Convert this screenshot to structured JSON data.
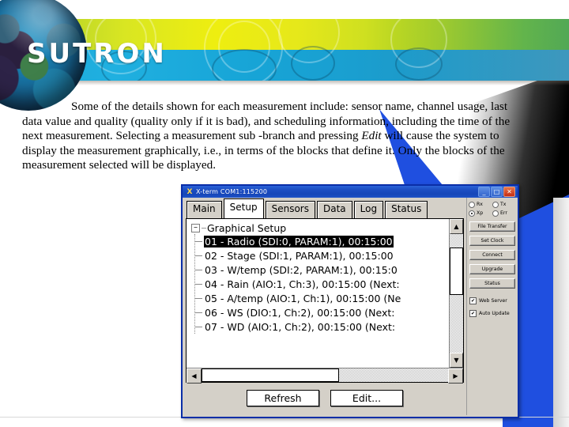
{
  "slide": {
    "brand": "SUTRON",
    "paragraph_runs": [
      {
        "t": "Some of the details shown for each measurement include: sensor name, channel usage, last data value and quality (quality only if it is bad), and scheduling information, including the time of the next measurement. Selecting a measurement sub -branch and pressing ",
        "italic": false
      },
      {
        "t": "Edit",
        "italic": true
      },
      {
        "t": " will cause the system to display the measurement graphically, i.e., in terms of the blocks that define it. Only the blocks of the measurement selected will be displayed.",
        "italic": false
      }
    ],
    "colors": {
      "banner_green": "#cfe020",
      "banner_blue": "#1aa6d8",
      "accent_blue": "#1f4fe0",
      "title_blue": "#1d4fc4"
    }
  },
  "window": {
    "title": "X-term COM1:115200",
    "title_icon": "terminal-icon",
    "controls": {
      "minimize": "_",
      "maximize": "□",
      "close": "✕"
    },
    "tabs": [
      {
        "label": "Main",
        "active": false
      },
      {
        "label": "Setup",
        "active": true
      },
      {
        "label": "Sensors",
        "active": false
      },
      {
        "label": "Data",
        "active": false
      },
      {
        "label": "Log",
        "active": false
      },
      {
        "label": "Status",
        "active": false
      }
    ],
    "tree": {
      "root_label": "Graphical Setup",
      "expander": "−",
      "items": [
        {
          "label": "01 - Radio (SDI:0, PARAM:1), 00:15:00",
          "selected": true
        },
        {
          "label": "02 - Stage (SDI:1, PARAM:1), 00:15:00",
          "selected": false
        },
        {
          "label": "03 - W/temp (SDI:2, PARAM:1), 00:15:0",
          "selected": false
        },
        {
          "label": "04 - Rain (AIO:1, Ch:3), 00:15:00 (Next:",
          "selected": false
        },
        {
          "label": "05 - A/temp (AIO:1, Ch:1), 00:15:00 (Ne",
          "selected": false
        },
        {
          "label": "06 - WS (DIO:1, Ch:2), 00:15:00 (Next:",
          "selected": false
        },
        {
          "label": "07 - WD (AIO:1, Ch:2), 00:15:00 (Next:",
          "selected": false
        }
      ]
    },
    "scroll": {
      "up_arrow": "▲",
      "down_arrow": "▼",
      "left_arrow": "◀",
      "right_arrow": "▶"
    },
    "buttons": [
      {
        "label": "Refresh"
      },
      {
        "label": "Edit..."
      }
    ],
    "side_panel": {
      "indicators": [
        {
          "label": "Rx",
          "on": false
        },
        {
          "label": "Tx",
          "on": false
        },
        {
          "label": "Xp",
          "on": true
        },
        {
          "label": "Err",
          "on": false
        }
      ],
      "buttons": [
        {
          "label": "File Transfer"
        },
        {
          "label": "Set Clock"
        },
        {
          "label": "Connect"
        },
        {
          "label": "Upgrade"
        },
        {
          "label": "Status"
        }
      ],
      "checkboxes": [
        {
          "label": "Web Server",
          "checked": true,
          "mark": "✔"
        },
        {
          "label": "Auto Update",
          "checked": true,
          "mark": "✔"
        }
      ]
    }
  }
}
